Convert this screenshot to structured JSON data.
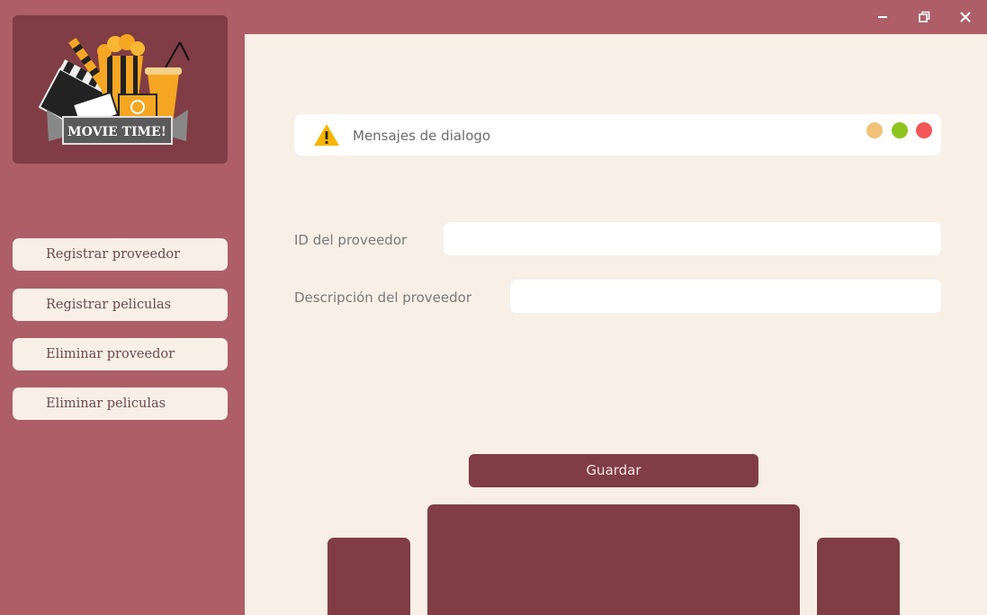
{
  "logo": {
    "text": "MOVIE TIME!"
  },
  "sidebar": {
    "items": [
      {
        "label": "Registrar proveedor"
      },
      {
        "label": "Registrar peliculas"
      },
      {
        "label": "Eliminar proveedor"
      },
      {
        "label": "Eliminar peliculas"
      }
    ]
  },
  "dialog": {
    "message": "Mensajes de dialogo",
    "dot_colors": [
      "#f0c27a",
      "#8fc31f",
      "#f25656"
    ]
  },
  "form": {
    "id_label": "ID del proveedor",
    "id_value": "",
    "desc_label": "Descripción del proveedor",
    "desc_value": ""
  },
  "actions": {
    "save_label": "Guardar"
  },
  "colors": {
    "sidebar_bg": "#ad5e66",
    "accent_dark": "#803d45",
    "content_bg": "#f8efe6"
  }
}
